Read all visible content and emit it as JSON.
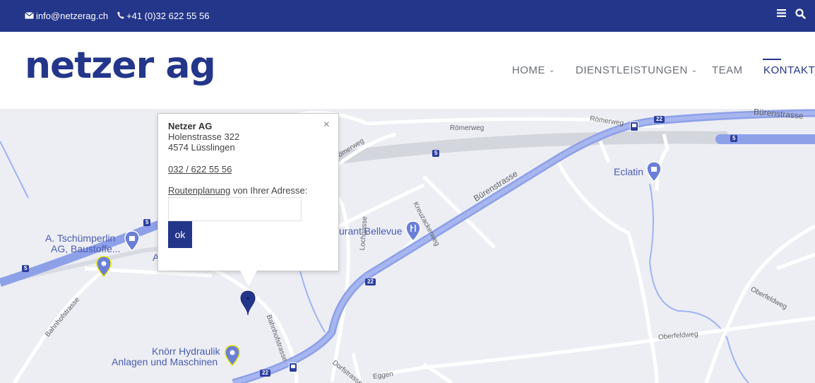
{
  "topbar": {
    "email": "info@netzerag.ch",
    "phone": "+41 (0)32 622 55 56",
    "email_icon": "envelope-icon",
    "phone_icon": "phone-icon",
    "menu_icon": "hamburger-menu-icon",
    "search_icon": "search-icon"
  },
  "header": {
    "logo": "netzer ag",
    "nav": {
      "home": "HOME",
      "services": "DIENSTLEISTUNGEN",
      "team": "TEAM",
      "contact": "KONTAKT"
    }
  },
  "popup": {
    "close": "×",
    "name": "Netzer AG",
    "street": "Holenstrasse 322",
    "city": "4574 Lüsslingen",
    "phone": "032 / 622 55 56",
    "route_link": "Routenplanung",
    "route_text": " von Ihrer Adresse:",
    "ok": "ok"
  },
  "map": {
    "roads": {
      "buerenstrasse_1": "Bürenstrasse",
      "buerenstrasse_2": "Bürenstrasse",
      "roemerweg_1": "Römerweg",
      "roemerweg_2": "Römerweg",
      "roemerweg_3": "Römerweg",
      "kreuzackerweg": "Kreuzackerweg",
      "lochgasse": "Lochgasse",
      "bahnhofstrasse_1": "Bahnhofstrasse",
      "bahnhofstrasse_2": "Bahnhofstrasse",
      "dorfstrasse": "Dorfstrasse",
      "eggen": "Eggen",
      "oberfeldweg_1": "Oberfeldweg",
      "oberfeldweg_2": "Oberfeldweg"
    },
    "shields": {
      "a5_1": "5",
      "a5_2": "5",
      "a5_3": "5",
      "a5_4": "5",
      "r22_1": "22",
      "r22_2": "22",
      "r22_3": "22"
    },
    "places": {
      "eclatin": "Eclatin",
      "bellevue": "urant Bellevue",
      "tschuemperlin_1": "A. Tschümperlin",
      "tschuemperlin_2": "AG, Baustoffe...",
      "knoerr_1": "Knörr Hydraulik",
      "knoerr_2": "Anlagen und Maschinen",
      "partial_a": "A"
    }
  }
}
